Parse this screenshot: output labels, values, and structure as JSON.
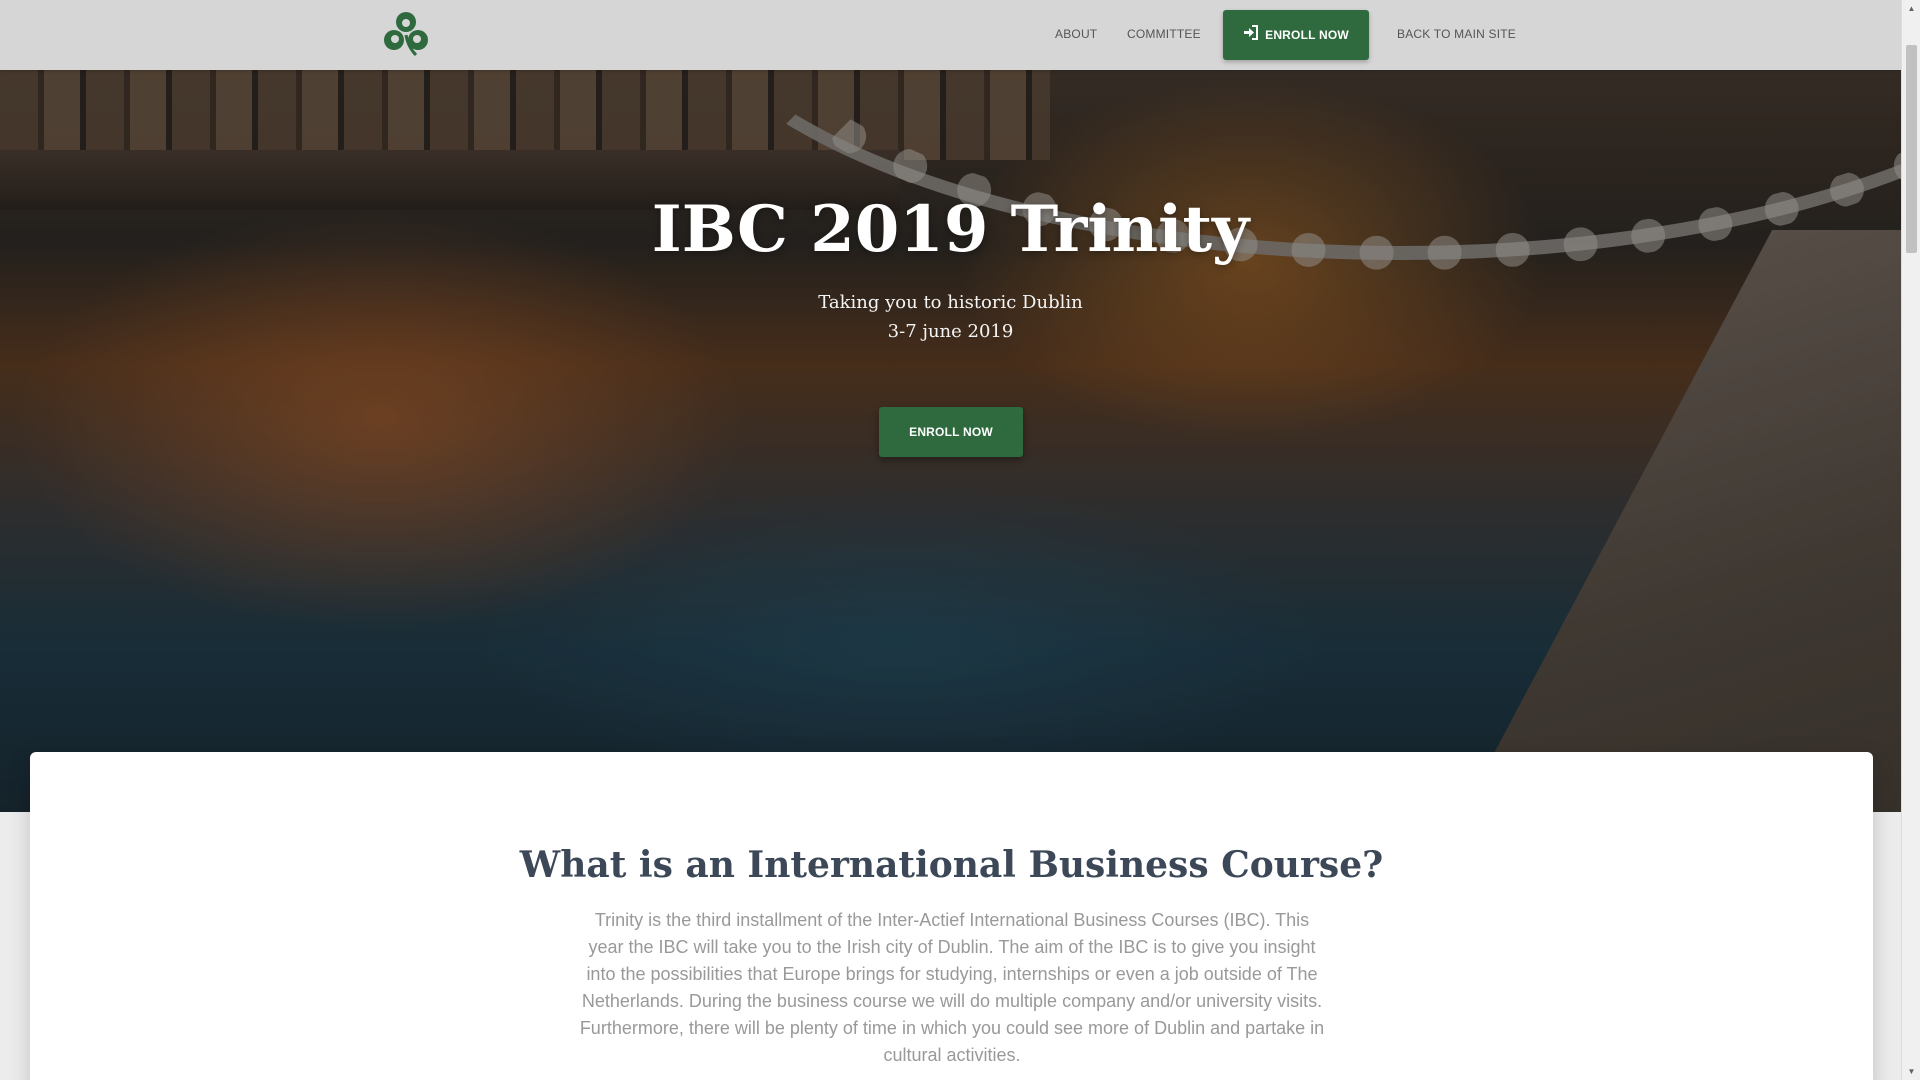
{
  "nav": {
    "about": "ABOUT",
    "committee": "COMMITTEE",
    "enroll": "ENROLL NOW",
    "back": "BACK TO MAIN SITE",
    "enroll_icon": "sign-in-icon",
    "logo_icon": "shamrock-logo-icon"
  },
  "hero": {
    "title": "IBC 2019 Trinity",
    "subtitle_line1": "Taking you to historic Dublin",
    "subtitle_line2": "3-7 june 2019",
    "button": "ENROLL NOW"
  },
  "about": {
    "heading": "What is an International Business Course?",
    "body": "Trinity is the third installment of the Inter-Actief International Business Courses (IBC). This year the IBC will take you to the Irish city of Dublin. The aim of the IBC is to give you insight into the possibilities that Europe brings for studying, internships or even a job outside of The Netherlands. During the business course we will do multiple company and/or university visits. Furthermore, there will be plenty of time in which you could see more of Dublin and partake in cultural activities."
  },
  "colors": {
    "brand_green": "#2e6a3e",
    "navbar_bg": "#d6d6d6",
    "heading": "#3c4858",
    "body_text": "#999999"
  }
}
